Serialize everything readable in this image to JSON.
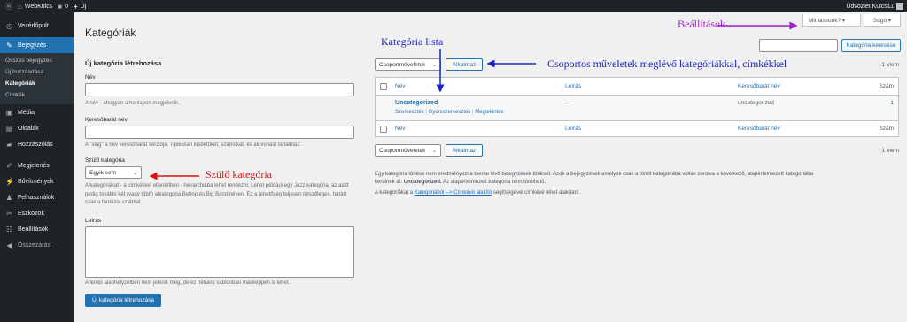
{
  "adminbar": {
    "site_name": "WebKulcs",
    "comments_count": "0",
    "new_label": "Új",
    "greeting": "Üdvözlet Kulcs11"
  },
  "sidebar": {
    "items": [
      {
        "label": "Vezérlőpult",
        "icon": "dashboard-icon"
      },
      {
        "label": "Bejegyzés",
        "icon": "pin-icon"
      },
      {
        "label": "Média",
        "icon": "media-icon"
      },
      {
        "label": "Oldalak",
        "icon": "pages-icon"
      },
      {
        "label": "Hozzászólás",
        "icon": "comments-icon"
      },
      {
        "label": "Megjelenés",
        "icon": "appearance-icon"
      },
      {
        "label": "Bővítmények",
        "icon": "plugins-icon"
      },
      {
        "label": "Felhasználók",
        "icon": "users-icon"
      },
      {
        "label": "Eszközök",
        "icon": "tools-icon"
      },
      {
        "label": "Beállítások",
        "icon": "settings-icon"
      },
      {
        "label": "Összezárás",
        "icon": "collapse-icon"
      }
    ],
    "submenu": [
      "Összes bejegyzés",
      "Új hozzáadása",
      "Kategóriák",
      "Címkék"
    ]
  },
  "page": {
    "title": "Kategóriák",
    "screen_options": "Mit lássunk? ▾",
    "help": "Súgó ▾"
  },
  "form": {
    "heading": "Új kategória létrehozása",
    "name_label": "Név",
    "name_help": "A név - ahogyan a honlapon megjelenik.",
    "slug_label": "Keresőbarát név",
    "slug_help": "A \"slug\" a név keresőbarát verziója. Tipikusan kisbetűket, számokat, és aluvonást tartalmaz.",
    "parent_label": "Szülő kategória",
    "parent_value": "Egyik sem",
    "parent_help": "A kategóriákat - a címkékkel ellentétben - hierarchiába lehet rendezni. Lehet például egy Jazz kategória, az alatt pedig további két (vagy több) alkategória Bebop és Big Band néven. Ez a lehetőség teljesen tetszőleges, határt csak a fantázia szabhat.",
    "desc_label": "Leírás",
    "desc_help": "A leírás alaphelyzetben nem jelenik meg, de ez néhány sablonban másképpen is lehet.",
    "submit_label": "Új kategória létrehozása"
  },
  "list": {
    "search_button": "Kategória keresése",
    "bulk_label": "Csoportműveletek",
    "apply_label": "Alkalmaz",
    "item_count": "1 elem",
    "columns": {
      "name": "Név",
      "description": "Leírás",
      "slug": "Keresőbarát név",
      "count": "Szám"
    },
    "rows": [
      {
        "name": "Uncategorized",
        "description": "—",
        "slug": "uncategorized",
        "count": "1",
        "actions": [
          "Szerkesztés",
          "Gyorsszerkesztés",
          "Megtekintés"
        ]
      }
    ]
  },
  "notes": {
    "line1": "Egy kategória törlése nem eredményezi a benne lévő bejegyzések törlését. Azok a bejegyzések amelyek csak a törölt kategóriába voltak sorolva a következő, alapértelmezett kategóriába",
    "line2_prefix": "kerülnek át:",
    "line2_bold": "Uncategorized.",
    "line2_suffix": "Az alapértelmezett kategória nem törölhető.",
    "line3_prefix": "A kategóriákat a",
    "line3_link": "Kategóriából --> Címkévé alakító",
    "line3_suffix": "segítségével címkévé lehet alakítani."
  },
  "annotations": {
    "settings": "Beállítások",
    "category_list": "Kategória lista",
    "bulk_actions": "Csoportos műveletek meglévő kategóriákkal, címkékkel",
    "parent_category": "Szülő kategória",
    "colors": {
      "purple": "#a020c8",
      "blue": "#1a22c8",
      "red": "#e01010"
    }
  },
  "colors": {
    "accent": "#2271b1",
    "admin_dark": "#1d2327",
    "background": "#f0f0f1"
  }
}
